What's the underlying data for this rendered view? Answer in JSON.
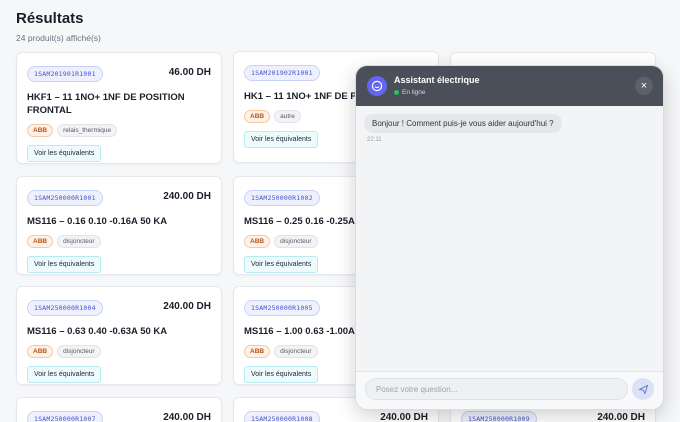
{
  "page": {
    "title": "Résultats",
    "count": "24 produit(s) affiché(s)"
  },
  "equiv_label": "Voir les équivalents",
  "cards": [
    {
      "ref": "1SAM201901R1001",
      "price": "46.00 DH",
      "name": "HKF1 – 11 1NO+ 1NF DE POSITION FRONTAL",
      "brand": "ABB",
      "category": "relais_thermique"
    },
    {
      "ref": "1SAM201902R1001",
      "price": "",
      "name": "HK1 – 11 1NO+ 1NF DE POS",
      "brand": "ABB",
      "category": "autre"
    },
    {
      "ref": "1SAM250000R1001",
      "price": "240.00 DH",
      "name": "MS116 – 0.16 0.10 -0.16A 50 KA",
      "brand": "ABB",
      "category": "disjoncteur"
    },
    {
      "ref": "1SAM250000R1002",
      "price": "",
      "name": "MS116 – 0.25 0.16 -0.25A 5",
      "brand": "ABB",
      "category": "disjoncteur"
    },
    {
      "ref": "1SAM250000R1004",
      "price": "240.00 DH",
      "name": "MS116 – 0.63 0.40 -0.63A 50 KA",
      "brand": "ABB",
      "category": "disjoncteur"
    },
    {
      "ref": "1SAM250000R1005",
      "price": "",
      "name": "MS116 – 1.00 0.63 -1.00A 5",
      "brand": "ABB",
      "category": "disjoncteur"
    },
    {
      "ref": "1SAM250000R1007",
      "price": "240.00 DH"
    },
    {
      "ref": "1SAM250000R1008",
      "price": "240.00 DH"
    },
    {
      "ref": "1SAM250000R1009",
      "price": "240.00 DH"
    }
  ],
  "chat": {
    "title": "Assistant électrique",
    "status": "En ligne",
    "message": "Bonjour ! Comment puis-je vous aider aujourd'hui ?",
    "time": "22:11",
    "placeholder": "Posez votre question...",
    "colors": {
      "header": "#4a4f5a",
      "avatar": "#6366f1",
      "online": "#22c55e"
    }
  }
}
